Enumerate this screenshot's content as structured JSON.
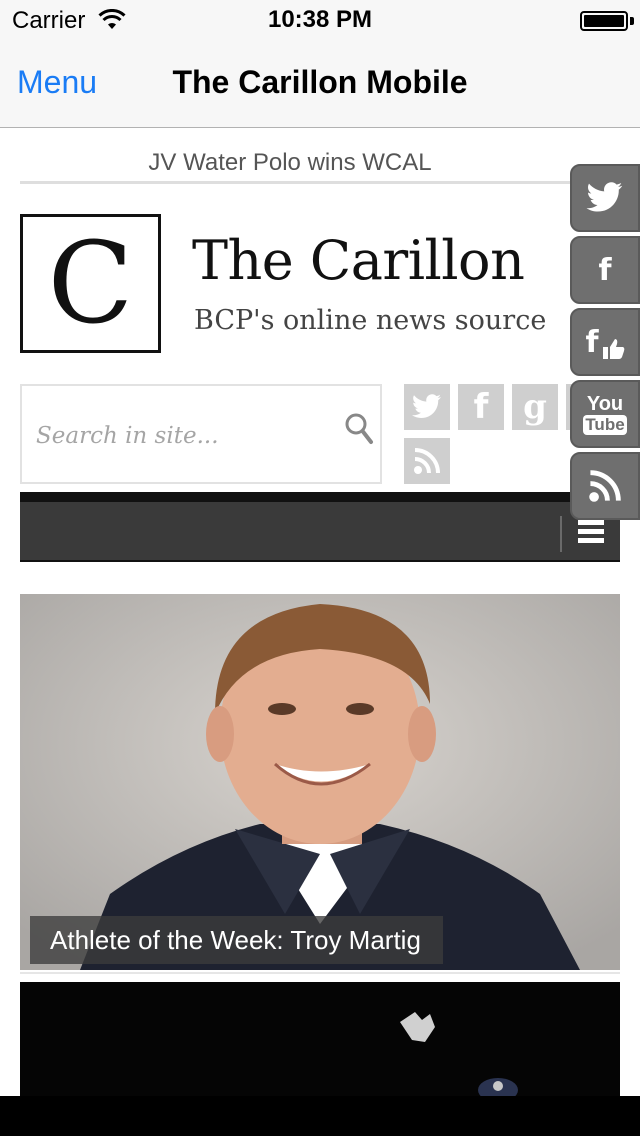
{
  "status_bar": {
    "carrier": "Carrier",
    "time": "10:38 PM",
    "icons": [
      "wifi-icon",
      "battery-icon"
    ]
  },
  "nav_bar": {
    "menu_label": "Menu",
    "title": "The Carillon Mobile",
    "accent_color": "#1a7cf5"
  },
  "page": {
    "ticker_headline": "JV Water Polo wins WCAL",
    "logo_letter": "C",
    "site_title": "The Carillon",
    "site_tagline": "BCP's online news source",
    "search_placeholder": "Search in site...",
    "social_buttons": [
      "twitter-icon",
      "facebook-icon",
      "google-icon",
      "youtube-icon",
      "rss-icon"
    ],
    "menu_icon": "hamburger-icon"
  },
  "floating_tabs": [
    {
      "name": "twitter-icon",
      "label": ""
    },
    {
      "name": "facebook-icon",
      "label": "f"
    },
    {
      "name": "facebook-like-icon",
      "label": "f"
    },
    {
      "name": "youtube-icon",
      "label_top": "You",
      "label_bottom": "Tube"
    },
    {
      "name": "rss-icon",
      "label": ""
    }
  ],
  "articles": [
    {
      "caption": "Athlete of the Week: Troy Martig"
    },
    {
      "caption": ""
    }
  ]
}
